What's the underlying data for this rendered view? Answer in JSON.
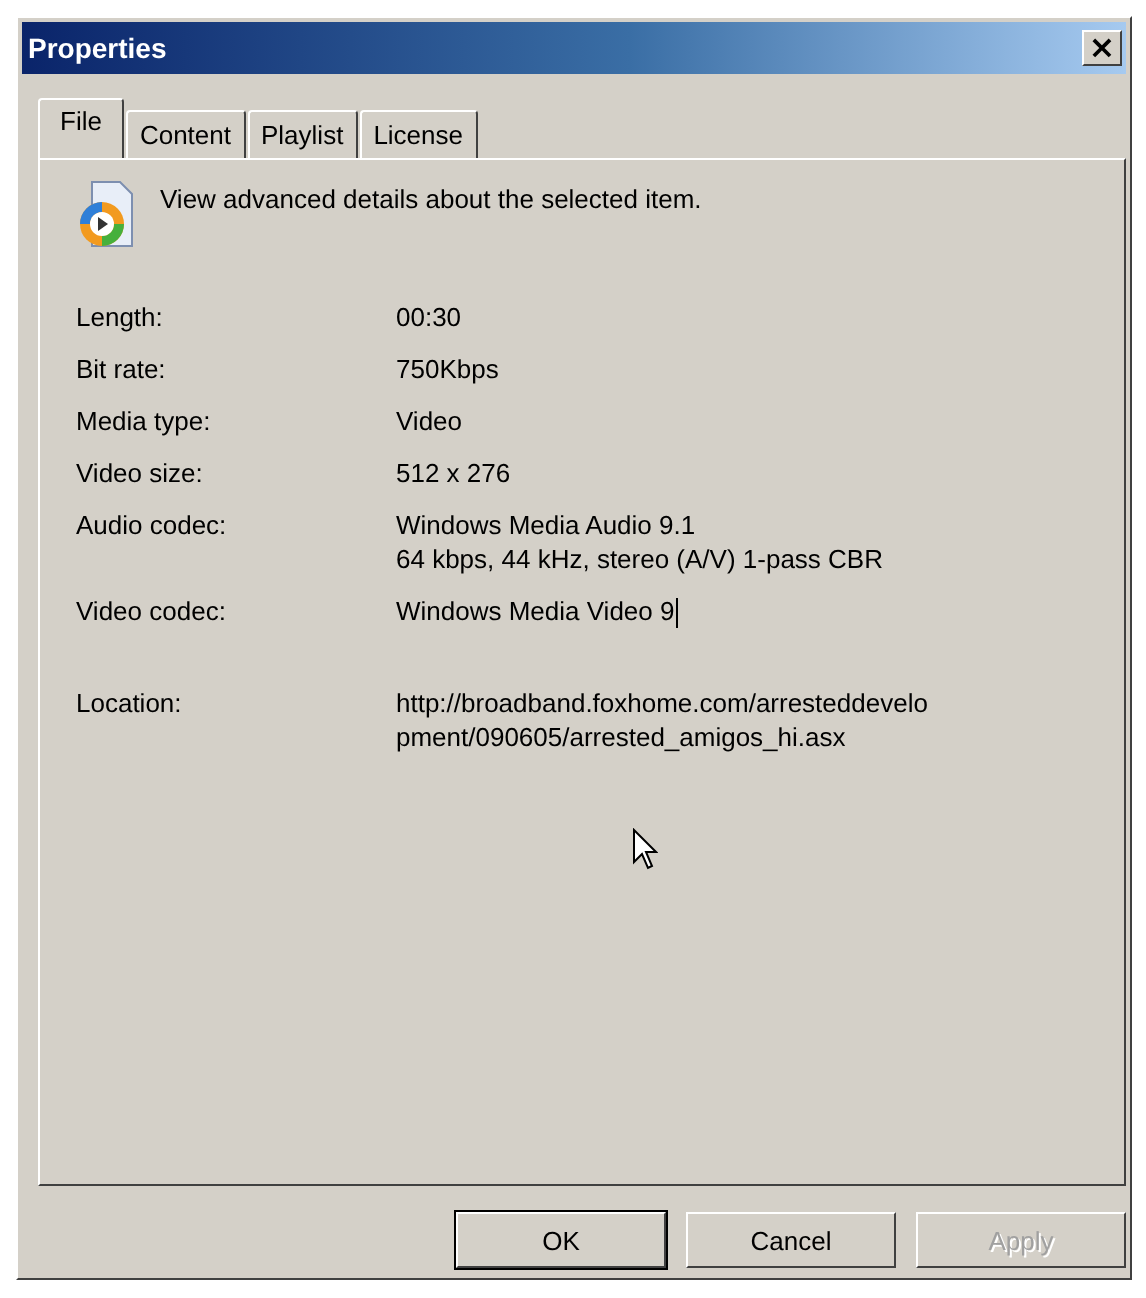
{
  "window": {
    "title": "Properties",
    "close": "×"
  },
  "tabs": [
    {
      "label": "File",
      "selected": true
    },
    {
      "label": "Content",
      "selected": false
    },
    {
      "label": "Playlist",
      "selected": false
    },
    {
      "label": "License",
      "selected": false
    }
  ],
  "header": {
    "text": "View advanced details about the selected item."
  },
  "details": [
    {
      "label": "Length:",
      "lines": [
        "00:30"
      ]
    },
    {
      "label": "Bit rate:",
      "lines": [
        "750Kbps"
      ]
    },
    {
      "label": "Media type:",
      "lines": [
        "Video"
      ]
    },
    {
      "label": "Video size:",
      "lines": [
        "512 x 276"
      ]
    },
    {
      "label": "Audio codec:",
      "lines": [
        "Windows Media Audio 9.1",
        "64 kbps, 44 kHz, stereo (A/V) 1-pass CBR"
      ]
    },
    {
      "label": "Video codec:",
      "lines": [
        "Windows Media Video 9"
      ],
      "caret": true
    },
    {
      "label": "Location:",
      "lines": [
        "http://broadband.foxhome.com/arresteddevelo",
        "pment/090605/arrested_amigos_hi.asx"
      ],
      "gap": true
    }
  ],
  "buttons": [
    {
      "label": "OK",
      "default": true,
      "disabled": false
    },
    {
      "label": "Cancel",
      "default": false,
      "disabled": false
    },
    {
      "label": "Apply",
      "default": false,
      "disabled": true
    }
  ]
}
